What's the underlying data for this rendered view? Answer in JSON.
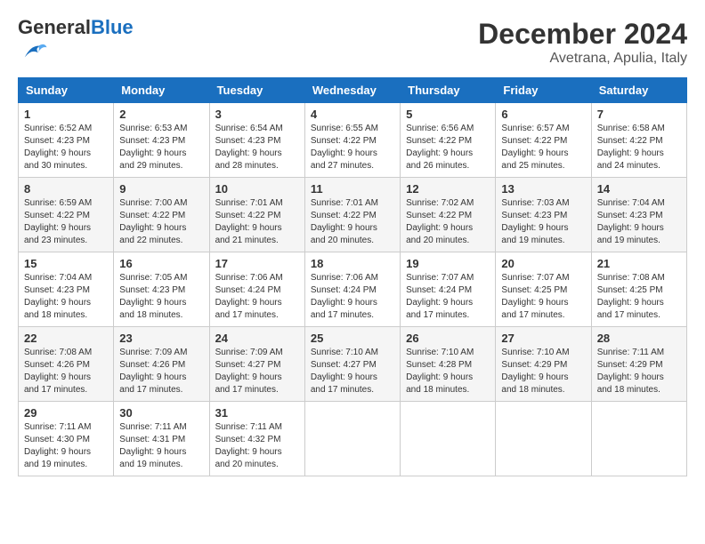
{
  "header": {
    "logo_text_general": "General",
    "logo_text_blue": "Blue",
    "month": "December 2024",
    "location": "Avetrana, Apulia, Italy"
  },
  "days_of_week": [
    "Sunday",
    "Monday",
    "Tuesday",
    "Wednesday",
    "Thursday",
    "Friday",
    "Saturday"
  ],
  "weeks": [
    [
      {
        "day": "1",
        "sunrise": "6:52 AM",
        "sunset": "4:23 PM",
        "daylight": "9 hours and 30 minutes."
      },
      {
        "day": "2",
        "sunrise": "6:53 AM",
        "sunset": "4:23 PM",
        "daylight": "9 hours and 29 minutes."
      },
      {
        "day": "3",
        "sunrise": "6:54 AM",
        "sunset": "4:23 PM",
        "daylight": "9 hours and 28 minutes."
      },
      {
        "day": "4",
        "sunrise": "6:55 AM",
        "sunset": "4:22 PM",
        "daylight": "9 hours and 27 minutes."
      },
      {
        "day": "5",
        "sunrise": "6:56 AM",
        "sunset": "4:22 PM",
        "daylight": "9 hours and 26 minutes."
      },
      {
        "day": "6",
        "sunrise": "6:57 AM",
        "sunset": "4:22 PM",
        "daylight": "9 hours and 25 minutes."
      },
      {
        "day": "7",
        "sunrise": "6:58 AM",
        "sunset": "4:22 PM",
        "daylight": "9 hours and 24 minutes."
      }
    ],
    [
      {
        "day": "8",
        "sunrise": "6:59 AM",
        "sunset": "4:22 PM",
        "daylight": "9 hours and 23 minutes."
      },
      {
        "day": "9",
        "sunrise": "7:00 AM",
        "sunset": "4:22 PM",
        "daylight": "9 hours and 22 minutes."
      },
      {
        "day": "10",
        "sunrise": "7:01 AM",
        "sunset": "4:22 PM",
        "daylight": "9 hours and 21 minutes."
      },
      {
        "day": "11",
        "sunrise": "7:01 AM",
        "sunset": "4:22 PM",
        "daylight": "9 hours and 20 minutes."
      },
      {
        "day": "12",
        "sunrise": "7:02 AM",
        "sunset": "4:22 PM",
        "daylight": "9 hours and 20 minutes."
      },
      {
        "day": "13",
        "sunrise": "7:03 AM",
        "sunset": "4:23 PM",
        "daylight": "9 hours and 19 minutes."
      },
      {
        "day": "14",
        "sunrise": "7:04 AM",
        "sunset": "4:23 PM",
        "daylight": "9 hours and 19 minutes."
      }
    ],
    [
      {
        "day": "15",
        "sunrise": "7:04 AM",
        "sunset": "4:23 PM",
        "daylight": "9 hours and 18 minutes."
      },
      {
        "day": "16",
        "sunrise": "7:05 AM",
        "sunset": "4:23 PM",
        "daylight": "9 hours and 18 minutes."
      },
      {
        "day": "17",
        "sunrise": "7:06 AM",
        "sunset": "4:24 PM",
        "daylight": "9 hours and 17 minutes."
      },
      {
        "day": "18",
        "sunrise": "7:06 AM",
        "sunset": "4:24 PM",
        "daylight": "9 hours and 17 minutes."
      },
      {
        "day": "19",
        "sunrise": "7:07 AM",
        "sunset": "4:24 PM",
        "daylight": "9 hours and 17 minutes."
      },
      {
        "day": "20",
        "sunrise": "7:07 AM",
        "sunset": "4:25 PM",
        "daylight": "9 hours and 17 minutes."
      },
      {
        "day": "21",
        "sunrise": "7:08 AM",
        "sunset": "4:25 PM",
        "daylight": "9 hours and 17 minutes."
      }
    ],
    [
      {
        "day": "22",
        "sunrise": "7:08 AM",
        "sunset": "4:26 PM",
        "daylight": "9 hours and 17 minutes."
      },
      {
        "day": "23",
        "sunrise": "7:09 AM",
        "sunset": "4:26 PM",
        "daylight": "9 hours and 17 minutes."
      },
      {
        "day": "24",
        "sunrise": "7:09 AM",
        "sunset": "4:27 PM",
        "daylight": "9 hours and 17 minutes."
      },
      {
        "day": "25",
        "sunrise": "7:10 AM",
        "sunset": "4:27 PM",
        "daylight": "9 hours and 17 minutes."
      },
      {
        "day": "26",
        "sunrise": "7:10 AM",
        "sunset": "4:28 PM",
        "daylight": "9 hours and 18 minutes."
      },
      {
        "day": "27",
        "sunrise": "7:10 AM",
        "sunset": "4:29 PM",
        "daylight": "9 hours and 18 minutes."
      },
      {
        "day": "28",
        "sunrise": "7:11 AM",
        "sunset": "4:29 PM",
        "daylight": "9 hours and 18 minutes."
      }
    ],
    [
      {
        "day": "29",
        "sunrise": "7:11 AM",
        "sunset": "4:30 PM",
        "daylight": "9 hours and 19 minutes."
      },
      {
        "day": "30",
        "sunrise": "7:11 AM",
        "sunset": "4:31 PM",
        "daylight": "9 hours and 19 minutes."
      },
      {
        "day": "31",
        "sunrise": "7:11 AM",
        "sunset": "4:32 PM",
        "daylight": "9 hours and 20 minutes."
      },
      null,
      null,
      null,
      null
    ]
  ],
  "labels": {
    "sunrise": "Sunrise:",
    "sunset": "Sunset:",
    "daylight": "Daylight:"
  }
}
